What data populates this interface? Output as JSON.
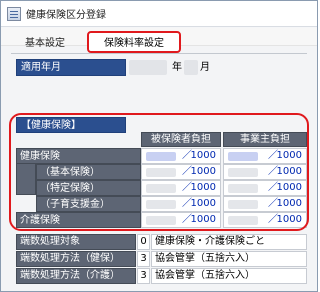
{
  "window": {
    "title": "健康保険区分登録"
  },
  "tabs": [
    {
      "label": "基本設定"
    },
    {
      "label": "保険料率設定"
    }
  ],
  "era": {
    "label": "適用年月",
    "year_suffix": "年",
    "month_suffix": "月"
  },
  "rates": {
    "section_label": "【健康保険】",
    "col_employee": "被保険者負担",
    "col_employer": "事業主負担",
    "denominator": "1000",
    "slash": "／",
    "rows": [
      {
        "label": "健康保険"
      },
      {
        "label": "（基本保険）"
      },
      {
        "label": "（特定保険）"
      },
      {
        "label": "（子育支援金）"
      },
      {
        "label": "介護保険"
      }
    ]
  },
  "rounding": [
    {
      "label": "端数処理対象",
      "code": "0",
      "value": "健康保険・介護保険ごと"
    },
    {
      "label": "端数処理方法（健保）",
      "code": "3",
      "value": "協会管掌（五捨六入）"
    },
    {
      "label": "端数処理方法（介護）",
      "code": "3",
      "value": "協会管掌（五捨六入）"
    }
  ],
  "colors": {
    "accent_red": "#e0191d",
    "label_blue": "#2b4f8f",
    "header_gray": "#5d6574",
    "value_blue": "#0028b0"
  }
}
